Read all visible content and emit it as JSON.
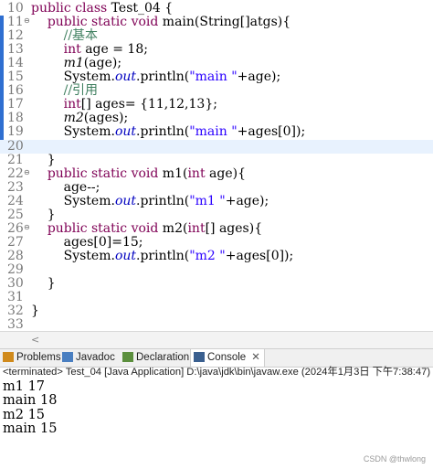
{
  "editor": {
    "lines": [
      {
        "n": "10",
        "segs": [
          [
            "kw",
            "public "
          ],
          [
            "kw",
            "class "
          ],
          [
            "",
            "Test_04 {"
          ]
        ]
      },
      {
        "n": "11",
        "fold": "⊖",
        "segs": [
          [
            "",
            "    "
          ],
          [
            "kw",
            "public "
          ],
          [
            "kw",
            "static "
          ],
          [
            "kw",
            "void "
          ],
          [
            "",
            "main(String[]atgs){"
          ]
        ]
      },
      {
        "n": "12",
        "segs": [
          [
            "",
            "        "
          ],
          [
            "cm",
            "//基本"
          ]
        ]
      },
      {
        "n": "13",
        "segs": [
          [
            "",
            "        "
          ],
          [
            "kw",
            "int "
          ],
          [
            "",
            "age = 18;"
          ]
        ]
      },
      {
        "n": "14",
        "segs": [
          [
            "",
            "        "
          ],
          [
            "it",
            "m1"
          ],
          [
            "",
            "(age);"
          ]
        ]
      },
      {
        "n": "15",
        "segs": [
          [
            "",
            "        System."
          ],
          [
            "fd",
            "out"
          ],
          [
            "",
            ".println("
          ],
          [
            "str",
            "\"main \""
          ],
          [
            "",
            "+age);"
          ]
        ]
      },
      {
        "n": "16",
        "segs": [
          [
            "",
            "        "
          ],
          [
            "cm",
            "//引用"
          ]
        ]
      },
      {
        "n": "17",
        "segs": [
          [
            "",
            "        "
          ],
          [
            "kw",
            "int"
          ],
          [
            "",
            "[] ages= {11,12,13};"
          ]
        ]
      },
      {
        "n": "18",
        "segs": [
          [
            "",
            "        "
          ],
          [
            "it",
            "m2"
          ],
          [
            "",
            "(ages);"
          ]
        ]
      },
      {
        "n": "19",
        "segs": [
          [
            "",
            "        System."
          ],
          [
            "fd",
            "out"
          ],
          [
            "",
            ".println("
          ],
          [
            "str",
            "\"main \""
          ],
          [
            "",
            "+ages[0]);"
          ]
        ]
      },
      {
        "n": "20",
        "current": true,
        "segs": []
      },
      {
        "n": "21",
        "segs": [
          [
            "",
            "    }"
          ]
        ]
      },
      {
        "n": "22",
        "fold": "⊖",
        "segs": [
          [
            "",
            "    "
          ],
          [
            "kw",
            "public "
          ],
          [
            "kw",
            "static "
          ],
          [
            "kw",
            "void "
          ],
          [
            "",
            "m1("
          ],
          [
            "kw",
            "int "
          ],
          [
            "",
            "age){"
          ]
        ]
      },
      {
        "n": "23",
        "segs": [
          [
            "",
            "        age--;"
          ]
        ]
      },
      {
        "n": "24",
        "segs": [
          [
            "",
            "        System."
          ],
          [
            "fd",
            "out"
          ],
          [
            "",
            ".println("
          ],
          [
            "str",
            "\"m1 \""
          ],
          [
            "",
            "+age);"
          ]
        ]
      },
      {
        "n": "25",
        "segs": [
          [
            "",
            "    }"
          ]
        ]
      },
      {
        "n": "26",
        "fold": "⊖",
        "segs": [
          [
            "",
            "    "
          ],
          [
            "kw",
            "public "
          ],
          [
            "kw",
            "static "
          ],
          [
            "kw",
            "void "
          ],
          [
            "",
            "m2("
          ],
          [
            "kw",
            "int"
          ],
          [
            "",
            "[] ages){"
          ]
        ]
      },
      {
        "n": "27",
        "segs": [
          [
            "",
            "        ages[0]=15;"
          ]
        ]
      },
      {
        "n": "28",
        "segs": [
          [
            "",
            "        System."
          ],
          [
            "fd",
            "out"
          ],
          [
            "",
            ".println("
          ],
          [
            "str",
            "\"m2 \""
          ],
          [
            "",
            "+ages[0]);"
          ]
        ]
      },
      {
        "n": "29",
        "segs": []
      },
      {
        "n": "30",
        "segs": [
          [
            "",
            "    }"
          ]
        ]
      },
      {
        "n": "31",
        "segs": []
      },
      {
        "n": "32",
        "segs": [
          [
            "",
            "}"
          ]
        ]
      },
      {
        "n": "33",
        "segs": []
      }
    ]
  },
  "tabs": [
    {
      "label": "Problems",
      "icon": "problems-icon",
      "color": "#d08a1c"
    },
    {
      "label": "Javadoc",
      "icon": "javadoc-icon",
      "color": "#4a7fc1"
    },
    {
      "label": "Declaration",
      "icon": "declaration-icon",
      "color": "#5b8f3d"
    },
    {
      "label": "Console",
      "icon": "console-icon",
      "color": "#3a5f8f",
      "active": true,
      "close": "✕"
    }
  ],
  "console": {
    "header": "<terminated> Test_04 [Java Application] D:\\java\\jdk\\bin\\javaw.exe  (2024年1月3日 下午7:38:47)",
    "output": [
      "m1 17",
      "main 18",
      "m2 15",
      "main 15"
    ]
  },
  "watermark": "CSDN @thwlong"
}
